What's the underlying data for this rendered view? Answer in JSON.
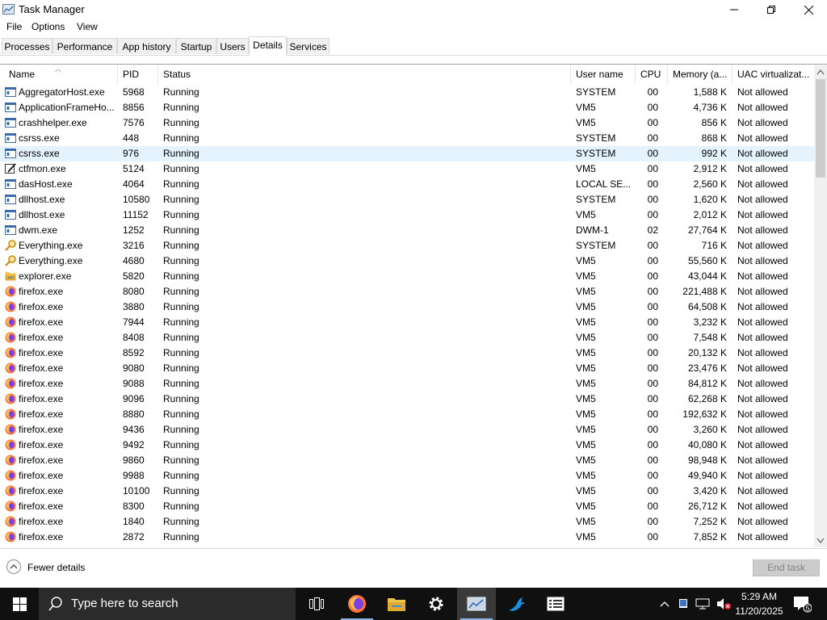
{
  "window": {
    "title": "Task Manager",
    "minimize": "—",
    "restore": "❐",
    "close": "✕"
  },
  "menu": [
    "File",
    "Options",
    "View"
  ],
  "tabs": [
    "Processes",
    "Performance",
    "App history",
    "Startup",
    "Users",
    "Details",
    "Services"
  ],
  "active_tab": "Details",
  "columns": [
    "Name",
    "PID",
    "Status",
    "User name",
    "CPU",
    "Memory (a...",
    "UAC virtualizat..."
  ],
  "selected_row": 4,
  "rows": [
    {
      "name": "AggregatorHost.exe",
      "pid": "5968",
      "status": "Running",
      "user": "SYSTEM",
      "cpu": "00",
      "mem": "1,588 K",
      "uac": "Not allowed",
      "icon": "window-icon"
    },
    {
      "name": "ApplicationFrameHo...",
      "pid": "8856",
      "status": "Running",
      "user": "VM5",
      "cpu": "00",
      "mem": "4,736 K",
      "uac": "Not allowed",
      "icon": "window-icon"
    },
    {
      "name": "crashhelper.exe",
      "pid": "7576",
      "status": "Running",
      "user": "VM5",
      "cpu": "00",
      "mem": "856 K",
      "uac": "Not allowed",
      "icon": "window-icon"
    },
    {
      "name": "csrss.exe",
      "pid": "448",
      "status": "Running",
      "user": "SYSTEM",
      "cpu": "00",
      "mem": "868 K",
      "uac": "Not allowed",
      "icon": "window-icon"
    },
    {
      "name": "csrss.exe",
      "pid": "976",
      "status": "Running",
      "user": "SYSTEM",
      "cpu": "00",
      "mem": "992 K",
      "uac": "Not allowed",
      "icon": "window-icon"
    },
    {
      "name": "ctfmon.exe",
      "pid": "5124",
      "status": "Running",
      "user": "VM5",
      "cpu": "00",
      "mem": "2,912 K",
      "uac": "Not allowed",
      "icon": "pen-icon"
    },
    {
      "name": "dasHost.exe",
      "pid": "4064",
      "status": "Running",
      "user": "LOCAL SE...",
      "cpu": "00",
      "mem": "2,560 K",
      "uac": "Not allowed",
      "icon": "window-icon"
    },
    {
      "name": "dllhost.exe",
      "pid": "10580",
      "status": "Running",
      "user": "SYSTEM",
      "cpu": "00",
      "mem": "1,620 K",
      "uac": "Not allowed",
      "icon": "window-icon"
    },
    {
      "name": "dllhost.exe",
      "pid": "11152",
      "status": "Running",
      "user": "VM5",
      "cpu": "00",
      "mem": "2,012 K",
      "uac": "Not allowed",
      "icon": "window-icon"
    },
    {
      "name": "dwm.exe",
      "pid": "1252",
      "status": "Running",
      "user": "DWM-1",
      "cpu": "02",
      "mem": "27,764 K",
      "uac": "Not allowed",
      "icon": "window-icon"
    },
    {
      "name": "Everything.exe",
      "pid": "3216",
      "status": "Running",
      "user": "SYSTEM",
      "cpu": "00",
      "mem": "716 K",
      "uac": "Not allowed",
      "icon": "magnifier-icon"
    },
    {
      "name": "Everything.exe",
      "pid": "4680",
      "status": "Running",
      "user": "VM5",
      "cpu": "00",
      "mem": "55,560 K",
      "uac": "Not allowed",
      "icon": "magnifier-icon"
    },
    {
      "name": "explorer.exe",
      "pid": "5820",
      "status": "Running",
      "user": "VM5",
      "cpu": "00",
      "mem": "43,044 K",
      "uac": "Not allowed",
      "icon": "folder-icon"
    },
    {
      "name": "firefox.exe",
      "pid": "8080",
      "status": "Running",
      "user": "VM5",
      "cpu": "00",
      "mem": "221,488 K",
      "uac": "Not allowed",
      "icon": "firefox-icon"
    },
    {
      "name": "firefox.exe",
      "pid": "3880",
      "status": "Running",
      "user": "VM5",
      "cpu": "00",
      "mem": "64,508 K",
      "uac": "Not allowed",
      "icon": "firefox-icon"
    },
    {
      "name": "firefox.exe",
      "pid": "7944",
      "status": "Running",
      "user": "VM5",
      "cpu": "00",
      "mem": "3,232 K",
      "uac": "Not allowed",
      "icon": "firefox-icon"
    },
    {
      "name": "firefox.exe",
      "pid": "8408",
      "status": "Running",
      "user": "VM5",
      "cpu": "00",
      "mem": "7,548 K",
      "uac": "Not allowed",
      "icon": "firefox-icon"
    },
    {
      "name": "firefox.exe",
      "pid": "8592",
      "status": "Running",
      "user": "VM5",
      "cpu": "00",
      "mem": "20,132 K",
      "uac": "Not allowed",
      "icon": "firefox-icon"
    },
    {
      "name": "firefox.exe",
      "pid": "9080",
      "status": "Running",
      "user": "VM5",
      "cpu": "00",
      "mem": "23,476 K",
      "uac": "Not allowed",
      "icon": "firefox-icon"
    },
    {
      "name": "firefox.exe",
      "pid": "9088",
      "status": "Running",
      "user": "VM5",
      "cpu": "00",
      "mem": "84,812 K",
      "uac": "Not allowed",
      "icon": "firefox-icon"
    },
    {
      "name": "firefox.exe",
      "pid": "9096",
      "status": "Running",
      "user": "VM5",
      "cpu": "00",
      "mem": "62,268 K",
      "uac": "Not allowed",
      "icon": "firefox-icon"
    },
    {
      "name": "firefox.exe",
      "pid": "8880",
      "status": "Running",
      "user": "VM5",
      "cpu": "00",
      "mem": "192,632 K",
      "uac": "Not allowed",
      "icon": "firefox-icon"
    },
    {
      "name": "firefox.exe",
      "pid": "9436",
      "status": "Running",
      "user": "VM5",
      "cpu": "00",
      "mem": "3,260 K",
      "uac": "Not allowed",
      "icon": "firefox-icon"
    },
    {
      "name": "firefox.exe",
      "pid": "9492",
      "status": "Running",
      "user": "VM5",
      "cpu": "00",
      "mem": "40,080 K",
      "uac": "Not allowed",
      "icon": "firefox-icon"
    },
    {
      "name": "firefox.exe",
      "pid": "9860",
      "status": "Running",
      "user": "VM5",
      "cpu": "00",
      "mem": "98,948 K",
      "uac": "Not allowed",
      "icon": "firefox-icon"
    },
    {
      "name": "firefox.exe",
      "pid": "9988",
      "status": "Running",
      "user": "VM5",
      "cpu": "00",
      "mem": "49,940 K",
      "uac": "Not allowed",
      "icon": "firefox-icon"
    },
    {
      "name": "firefox.exe",
      "pid": "10100",
      "status": "Running",
      "user": "VM5",
      "cpu": "00",
      "mem": "3,420 K",
      "uac": "Not allowed",
      "icon": "firefox-icon"
    },
    {
      "name": "firefox.exe",
      "pid": "8300",
      "status": "Running",
      "user": "VM5",
      "cpu": "00",
      "mem": "26,712 K",
      "uac": "Not allowed",
      "icon": "firefox-icon"
    },
    {
      "name": "firefox.exe",
      "pid": "1840",
      "status": "Running",
      "user": "VM5",
      "cpu": "00",
      "mem": "7,252 K",
      "uac": "Not allowed",
      "icon": "firefox-icon"
    },
    {
      "name": "firefox.exe",
      "pid": "2872",
      "status": "Running",
      "user": "VM5",
      "cpu": "00",
      "mem": "7,852 K",
      "uac": "Not allowed",
      "icon": "firefox-icon"
    }
  ],
  "footer": {
    "fewer_details": "Fewer details",
    "end_task": "End task"
  },
  "taskbar": {
    "search_placeholder": "Type here to search",
    "time": "5:29 AM",
    "date": "11/20/2025",
    "notification_count": "5"
  }
}
